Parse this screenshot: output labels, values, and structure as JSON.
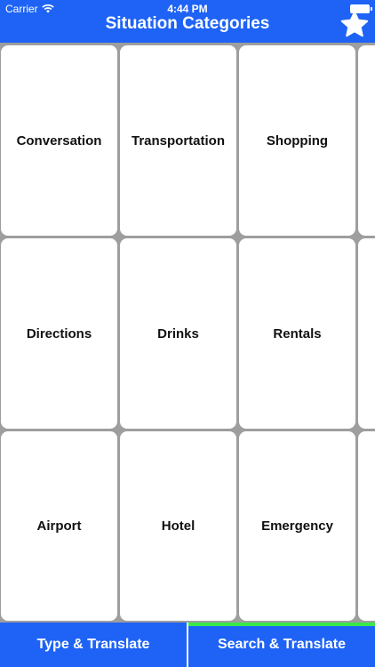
{
  "status_bar": {
    "carrier": "Carrier",
    "time": "4:44 PM"
  },
  "nav": {
    "title": "Situation Categories",
    "favorites_icon": "star-icon"
  },
  "categories": [
    {
      "label": "Conversation"
    },
    {
      "label": "Transportation"
    },
    {
      "label": "Shopping"
    },
    {
      "label": "Directions"
    },
    {
      "label": "Drinks"
    },
    {
      "label": "Rentals"
    },
    {
      "label": "Airport"
    },
    {
      "label": "Hotel"
    },
    {
      "label": "Emergency"
    }
  ],
  "tabs": {
    "type_translate": "Type & Translate",
    "search_translate": "Search & Translate",
    "selected": "search_translate"
  },
  "colors": {
    "accent": "#1e63f5",
    "selected_indicator": "#39e84a",
    "grid_background": "#9e9e9e"
  }
}
